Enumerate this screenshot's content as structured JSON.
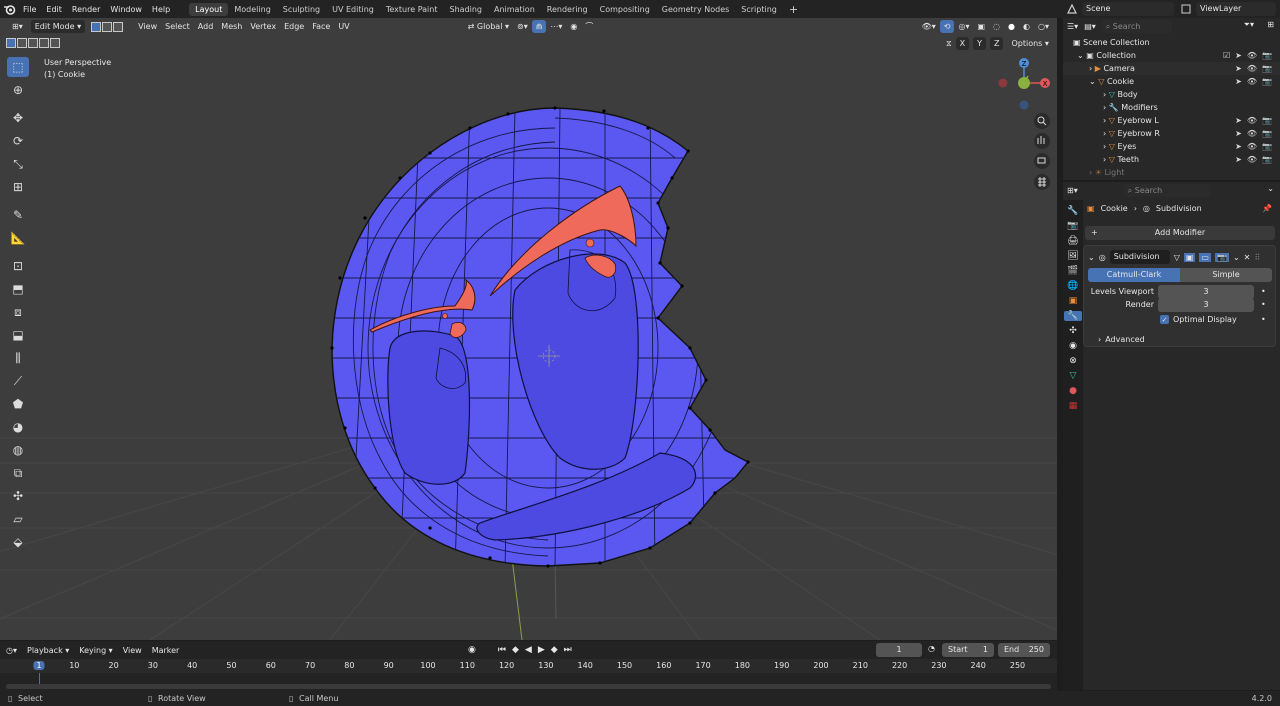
{
  "menu": {
    "items": [
      "File",
      "Edit",
      "Render",
      "Window",
      "Help"
    ]
  },
  "workspaces": {
    "tabs": [
      "Layout",
      "Modeling",
      "Sculpting",
      "UV Editing",
      "Texture Paint",
      "Shading",
      "Animation",
      "Rendering",
      "Compositing",
      "Geometry Nodes",
      "Scripting"
    ],
    "active": "Layout",
    "add_icon": "+"
  },
  "scene": {
    "name": "Scene",
    "view_layer": "ViewLayer"
  },
  "viewport_header": {
    "mode": "Edit Mode",
    "menus": [
      "View",
      "Select",
      "Add",
      "Mesh",
      "Vertex",
      "Edge",
      "Face",
      "UV"
    ],
    "transform_orientation": "Global",
    "axes": [
      "X",
      "Y",
      "Z"
    ],
    "options_label": "Options"
  },
  "viewport_overlay": {
    "perspective": "User Perspective",
    "object": "(1) Cookie"
  },
  "outliner": {
    "search_placeholder": "Search",
    "root": "Scene Collection",
    "collection": "Collection",
    "items": [
      {
        "name": "Camera",
        "indent": 1
      },
      {
        "name": "Cookie",
        "indent": 1
      },
      {
        "name": "Body",
        "indent": 2
      },
      {
        "name": "Modifiers",
        "indent": 2
      },
      {
        "name": "Eyebrow L",
        "indent": 2
      },
      {
        "name": "Eyebrow R",
        "indent": 2
      },
      {
        "name": "Eyes",
        "indent": 2
      },
      {
        "name": "Teeth",
        "indent": 2
      },
      {
        "name": "Light",
        "indent": 1
      }
    ]
  },
  "properties": {
    "search_placeholder": "Search",
    "breadcrumb_object": "Cookie",
    "breadcrumb_modifier": "Subdivision",
    "add_modifier": "Add Modifier",
    "modifier_name": "Subdivision",
    "type_options": [
      "Catmull-Clark",
      "Simple"
    ],
    "type_selected": "Catmull-Clark",
    "levels_viewport_label": "Levels Viewport",
    "levels_viewport": "3",
    "render_label": "Render",
    "render_value": "3",
    "optimal_display_label": "Optimal Display",
    "optimal_display": true,
    "advanced_label": "Advanced"
  },
  "timeline": {
    "menus": [
      "Playback",
      "Keying",
      "View",
      "Marker"
    ],
    "current_frame": "1",
    "start_label": "Start",
    "start": "1",
    "end_label": "End",
    "end": "250",
    "ticks": [
      "1",
      "10",
      "20",
      "30",
      "40",
      "50",
      "60",
      "70",
      "80",
      "90",
      "100",
      "110",
      "120",
      "130",
      "140",
      "150",
      "160",
      "170",
      "180",
      "190",
      "200",
      "210",
      "220",
      "230",
      "240",
      "250"
    ]
  },
  "statusbar": {
    "select": "Select",
    "rotate": "Rotate View",
    "call_menu": "Call Menu",
    "version": "4.2.0"
  },
  "colors": {
    "accent": "#4772b3",
    "mesh_face": "#5a58f0",
    "eyebrow": "#ef6a5a",
    "viewport_bg": "#3d3d3d"
  }
}
